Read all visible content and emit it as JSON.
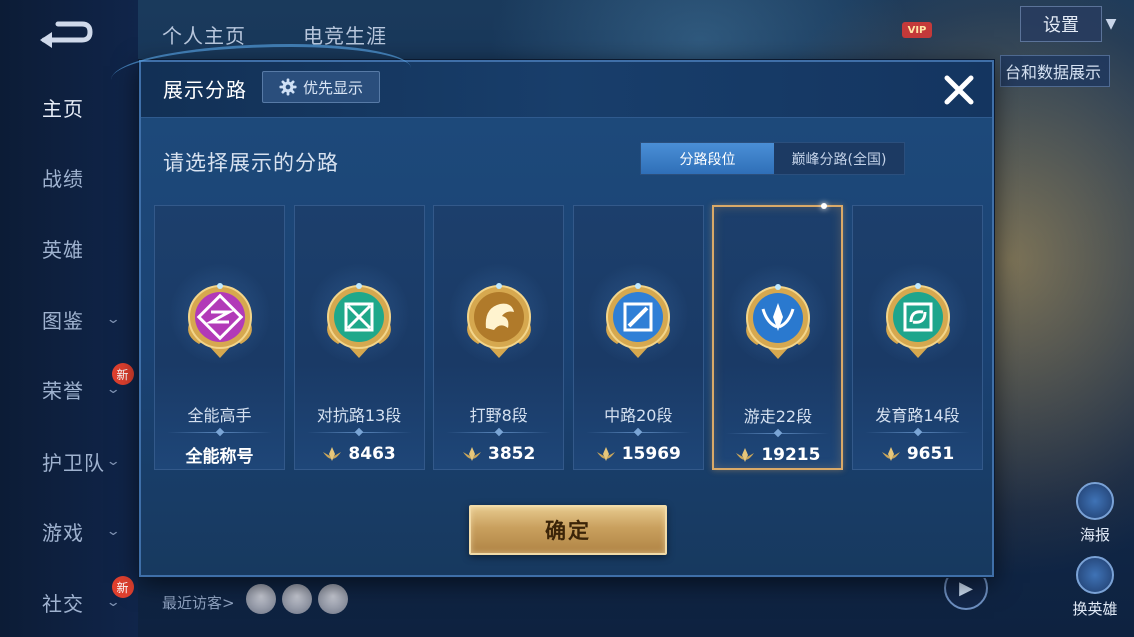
{
  "background": {
    "top_tabs": [
      "个人主页",
      "电竞生涯"
    ],
    "settings_label": "设置",
    "vip_label": "VIP",
    "behind_text": "台和数据展示",
    "sidebar": [
      {
        "label": "主页",
        "active": true,
        "chevron": false,
        "badge": ""
      },
      {
        "label": "战绩",
        "active": false,
        "chevron": false,
        "badge": ""
      },
      {
        "label": "英雄",
        "active": false,
        "chevron": false,
        "badge": ""
      },
      {
        "label": "图鉴",
        "active": false,
        "chevron": true,
        "badge": ""
      },
      {
        "label": "荣誉",
        "active": false,
        "chevron": true,
        "badge": "新"
      },
      {
        "label": "护卫队",
        "active": false,
        "chevron": true,
        "badge": ""
      },
      {
        "label": "游戏",
        "active": false,
        "chevron": true,
        "badge": ""
      },
      {
        "label": "社交",
        "active": false,
        "chevron": true,
        "badge": "新"
      }
    ],
    "recent_visitors_label": "最近访客>",
    "right_floats": [
      "海报",
      "换英雄"
    ]
  },
  "modal": {
    "title": "展示分路",
    "priority_button": "优先显示",
    "close_icon": "close-icon",
    "subtitle": "请选择展示的分路",
    "segments": [
      {
        "label": "分路段位",
        "active": true
      },
      {
        "label": "巅峰分路(全国)",
        "active": false
      }
    ],
    "cards": [
      {
        "name": "全能高手",
        "footer": "全能称号",
        "show_points_icon": false,
        "selected": false,
        "emblem": "all-round-emblem-icon",
        "color": "#b23ab8"
      },
      {
        "name": "对抗路13段",
        "footer": "8463",
        "show_points_icon": true,
        "selected": false,
        "emblem": "clash-lane-emblem-icon",
        "color": "#1fa88a"
      },
      {
        "name": "打野8段",
        "footer": "3852",
        "show_points_icon": true,
        "selected": false,
        "emblem": "jungle-emblem-icon",
        "color": "#b07a2a"
      },
      {
        "name": "中路20段",
        "footer": "15969",
        "show_points_icon": true,
        "selected": false,
        "emblem": "mid-lane-emblem-icon",
        "color": "#2f7fd6"
      },
      {
        "name": "游走22段",
        "footer": "19215",
        "show_points_icon": true,
        "selected": true,
        "emblem": "roam-emblem-icon",
        "color": "#2a79cf"
      },
      {
        "name": "发育路14段",
        "footer": "9651",
        "show_points_icon": true,
        "selected": false,
        "emblem": "farm-lane-emblem-icon",
        "color": "#1ea58c"
      }
    ],
    "confirm_button": "确定"
  },
  "colors": {
    "accent_gold": "#d9a968",
    "segment_active": "#3a7fc8",
    "modal_bg": "#1a4273"
  }
}
